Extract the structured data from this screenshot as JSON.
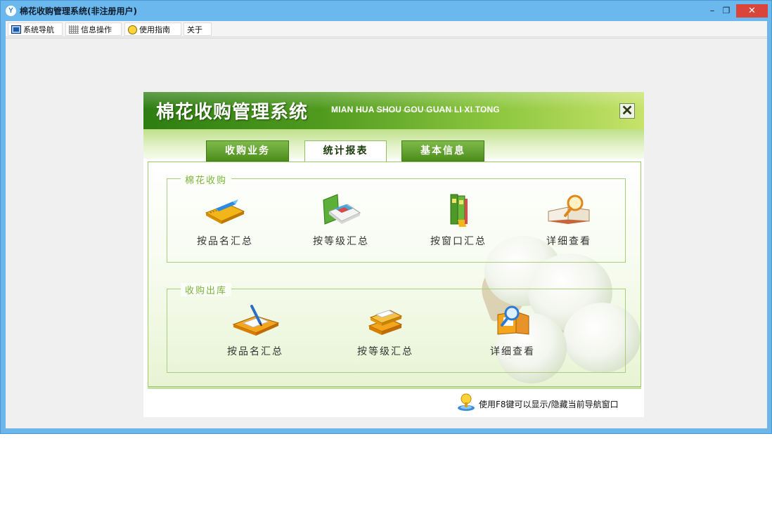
{
  "window": {
    "title": "棉花收购管理系统(非注册用户)",
    "icon": "app-logo-icon",
    "controls": {
      "minimize": "–",
      "restore": "❐",
      "close": "✕"
    }
  },
  "menubar": {
    "items": [
      {
        "label": "系统导航",
        "icon": "monitor-icon"
      },
      {
        "label": "信息操作",
        "icon": "grid-icon"
      },
      {
        "label": "使用指南",
        "icon": "lightbulb-icon"
      },
      {
        "label": "关于"
      }
    ]
  },
  "panel": {
    "title": "棉花收购管理系统",
    "subtitle": "MIAN HUA SHOU GOU GUAN LI XI TONG",
    "close_label": "✕",
    "tabs": [
      {
        "label": "收购业务",
        "active": false
      },
      {
        "label": "统计报表",
        "active": true
      },
      {
        "label": "基本信息",
        "active": false
      }
    ],
    "groups": [
      {
        "title": "棉花收购",
        "items": [
          {
            "label": "按品名汇总",
            "icon": "notebook-pen-icon"
          },
          {
            "label": "按等级汇总",
            "icon": "folder-documents-icon"
          },
          {
            "label": "按窗口汇总",
            "icon": "binders-icon"
          },
          {
            "label": "详细查看",
            "icon": "magnifier-book-icon"
          }
        ]
      },
      {
        "title": "收购出库",
        "items": [
          {
            "label": "按品名汇总",
            "icon": "notebook-pen-icon"
          },
          {
            "label": "按等级汇总",
            "icon": "stacked-books-icon"
          },
          {
            "label": "详细查看",
            "icon": "magnifier-folder-icon"
          }
        ]
      }
    ],
    "hint": "使用F8键可以显示/隐藏当前导航窗口"
  },
  "colors": {
    "titlebar": "#6ab8ee",
    "close_button": "#d9453a",
    "banner_green": "#4f9a1e",
    "group_title": "#7cb43c"
  }
}
